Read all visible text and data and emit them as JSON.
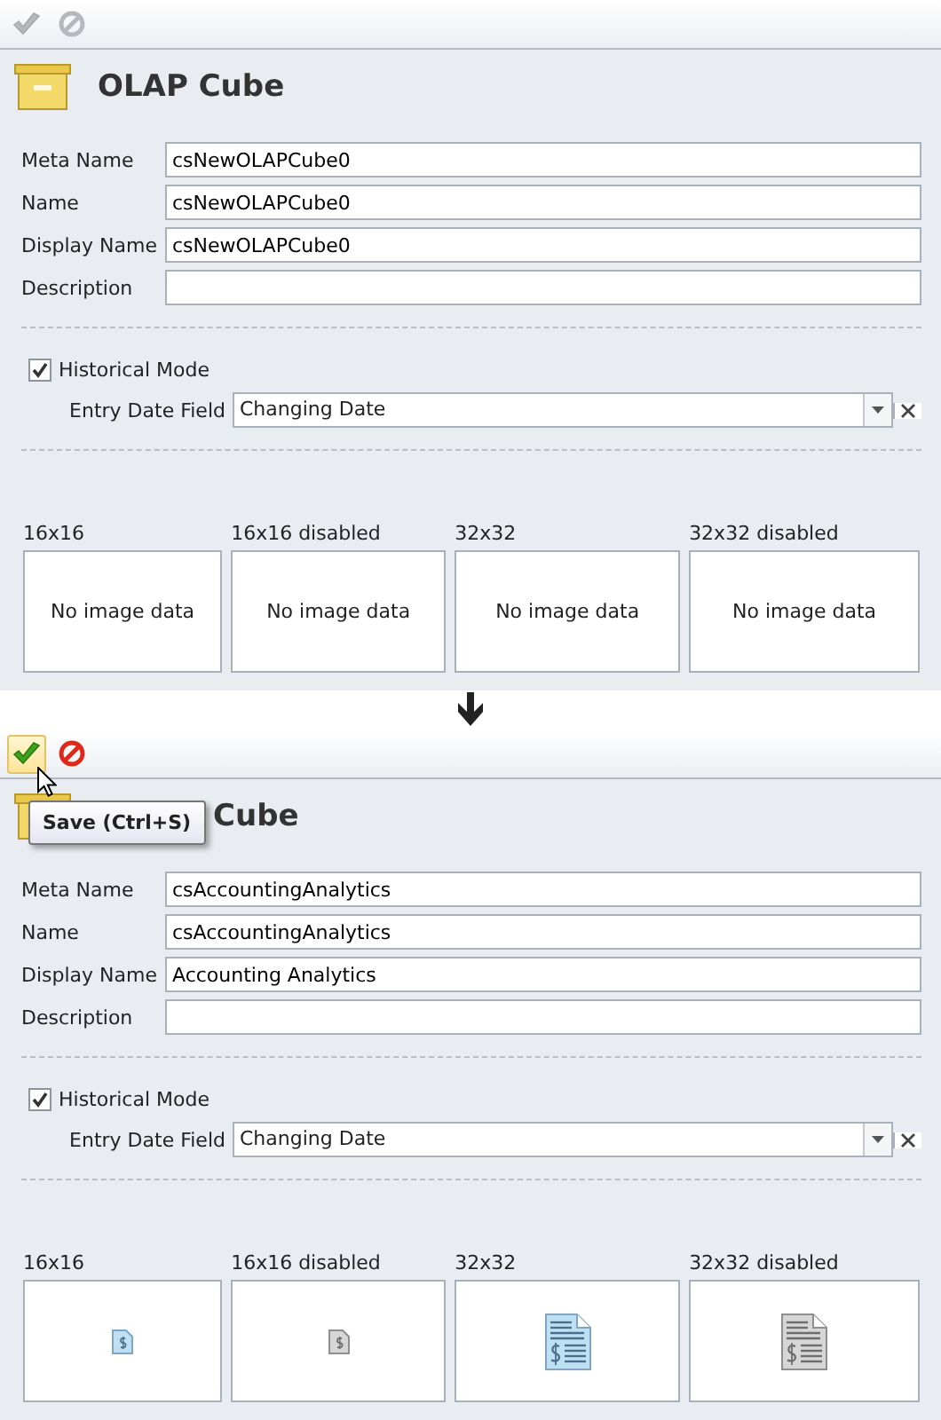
{
  "panels": [
    {
      "toolbar": [
        {
          "kind": "save",
          "disabled": true,
          "hovered": false
        },
        {
          "kind": "cancel",
          "disabled": true,
          "hovered": false
        }
      ],
      "title": "OLAP Cube",
      "fields": [
        {
          "label": "Meta Name",
          "value": "csNewOLAPCube0"
        },
        {
          "label": "Name",
          "value": "csNewOLAPCube0"
        },
        {
          "label": "Display Name",
          "value": "csNewOLAPCube0"
        },
        {
          "label": "Description"
        }
      ],
      "historical_mode": {
        "label": "Historical Mode",
        "checked": true
      },
      "entry_date_field": {
        "label": "Entry Date Field",
        "value": "Changing Date"
      },
      "images": [
        {
          "label": "16x16",
          "kind": "empty",
          "text": "No image data"
        },
        {
          "label": "16x16 disabled",
          "kind": "empty",
          "text": "No image data"
        },
        {
          "label": "32x32",
          "kind": "empty",
          "text": "No image data"
        },
        {
          "label": "32x32 disabled",
          "kind": "empty",
          "text": "No image data"
        }
      ]
    },
    {
      "toolbar": [
        {
          "kind": "save",
          "disabled": false,
          "hovered": true
        },
        {
          "kind": "cancel",
          "disabled": false,
          "hovered": false
        }
      ],
      "tooltip": {
        "text": "Save (Ctrl+S)"
      },
      "title": "Cube",
      "fields": [
        {
          "label": "Meta Name",
          "value": "csAccountingAnalytics"
        },
        {
          "label": "Name",
          "value": "csAccountingAnalytics"
        },
        {
          "label": "Display Name",
          "value": "Accounting Analytics"
        },
        {
          "label": "Description"
        }
      ],
      "historical_mode": {
        "label": "Historical Mode",
        "checked": true
      },
      "entry_date_field": {
        "label": "Entry Date Field",
        "value": "Changing Date"
      },
      "images": [
        {
          "label": "16x16",
          "kind": "small_icon",
          "disabled": false
        },
        {
          "label": "16x16 disabled",
          "kind": "small_icon",
          "disabled": true
        },
        {
          "label": "32x32",
          "kind": "large_icon",
          "disabled": false
        },
        {
          "label": "32x32 disabled",
          "kind": "large_icon",
          "disabled": true
        }
      ]
    }
  ]
}
